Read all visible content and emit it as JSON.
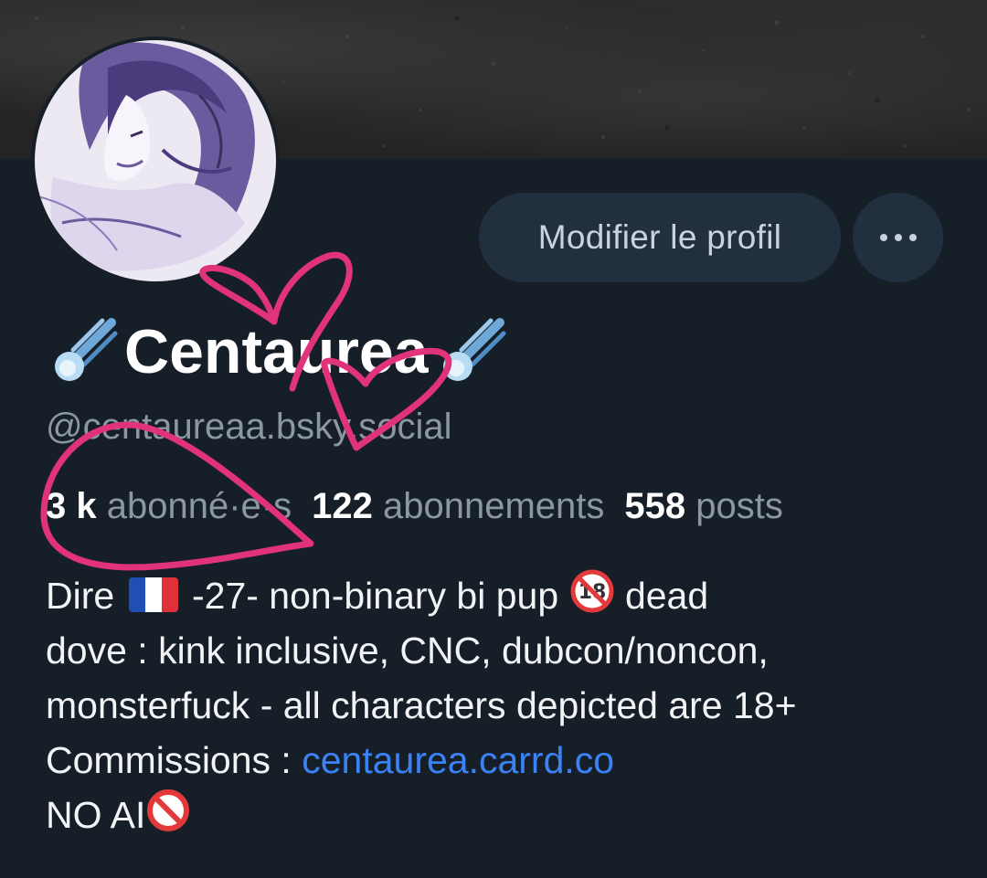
{
  "profile": {
    "display_name": "Centaurea",
    "name_emoji": "comet-icon",
    "handle": "@centaureaa.bsky.social",
    "edit_button_label": "Modifier le profil",
    "more_button": "more-options-icon"
  },
  "stats": {
    "followers_count": "3 k",
    "followers_label": "abonné·e·s",
    "following_count": "122",
    "following_label": "abonnements",
    "posts_count": "558",
    "posts_label": "posts"
  },
  "bio": {
    "line1_a": "Dire",
    "line1_b": "-27- non-binary bi pup",
    "line1_c": "dead",
    "line2": "dove : kink inclusive, CNC, dubcon/noncon,",
    "line3": "monsterfuck - all characters depicted are 18+",
    "line4_prefix": "Commissions : ",
    "line4_link": "centaurea.carrd.co",
    "line5": "NO AI"
  },
  "colors": {
    "background": "#161e27",
    "button_bg": "#222f3e",
    "muted_text": "#8b97a5",
    "link": "#3b82f6",
    "annotation_pink": "#e0337a"
  }
}
